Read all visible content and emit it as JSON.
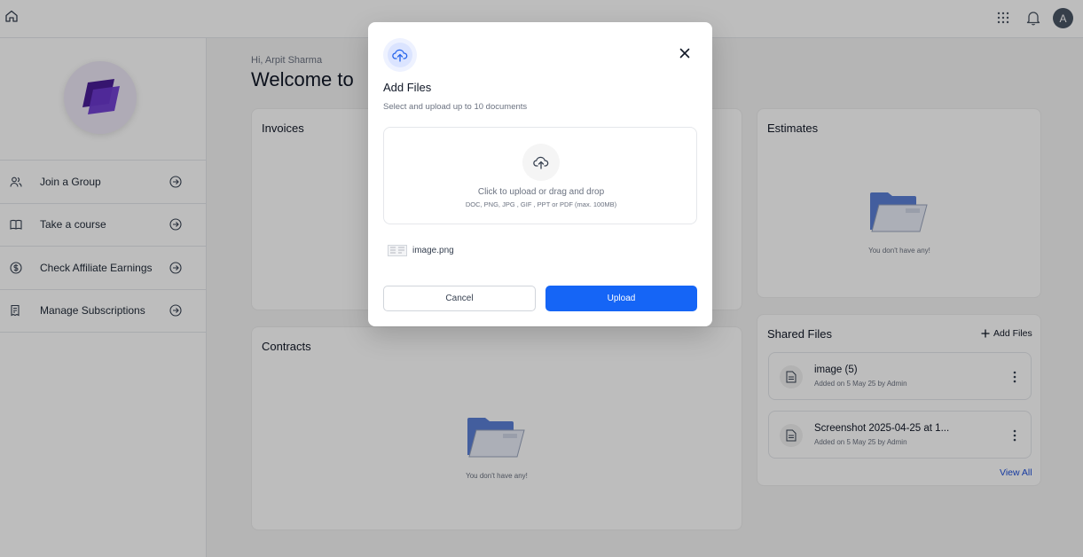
{
  "topbar": {
    "icons": {
      "home": "home-icon",
      "apps": "grid-icon",
      "notifications": "bell-icon"
    },
    "avatar_initial": "A",
    "avatar_color": "#4a5565"
  },
  "sidebar": {
    "items": [
      {
        "label": "Join a Group",
        "icon": "users-icon"
      },
      {
        "label": "Take a course",
        "icon": "book-icon"
      },
      {
        "label": "Check Affiliate Earnings",
        "icon": "dollar-icon"
      },
      {
        "label": "Manage Subscriptions",
        "icon": "receipt-icon"
      }
    ]
  },
  "main": {
    "greeting": "Hi, Arpit Sharma",
    "welcome": "Welcome to",
    "invoices": {
      "title": "Invoices"
    },
    "contracts": {
      "title": "Contracts",
      "empty": "You don't have any!"
    },
    "estimates": {
      "title": "Estimates",
      "empty": "You don't have any!"
    },
    "shared_files": {
      "title": "Shared Files",
      "add_label": "Add Files",
      "files": [
        {
          "name": "image (5)",
          "meta": "Added on 5 May 25 by Admin"
        },
        {
          "name": "Screenshot 2025-04-25 at 1...",
          "meta": "Added on 5 May 25 by Admin"
        }
      ],
      "view_all": "View All"
    }
  },
  "modal": {
    "title": "Add Files",
    "subtitle": "Select and upload up to 10 documents",
    "dropzone": {
      "main": "Click to upload or drag and drop",
      "hint": "DOC, PNG, JPG , GIF , PPT or PDF (max. 100MB)"
    },
    "attachment": "image.png",
    "cancel": "Cancel",
    "upload": "Upload"
  },
  "colors": {
    "primary": "#1565f6",
    "link": "#1d4ed8",
    "folder": "#5b7fd6",
    "logo": "#5b2bb5"
  }
}
